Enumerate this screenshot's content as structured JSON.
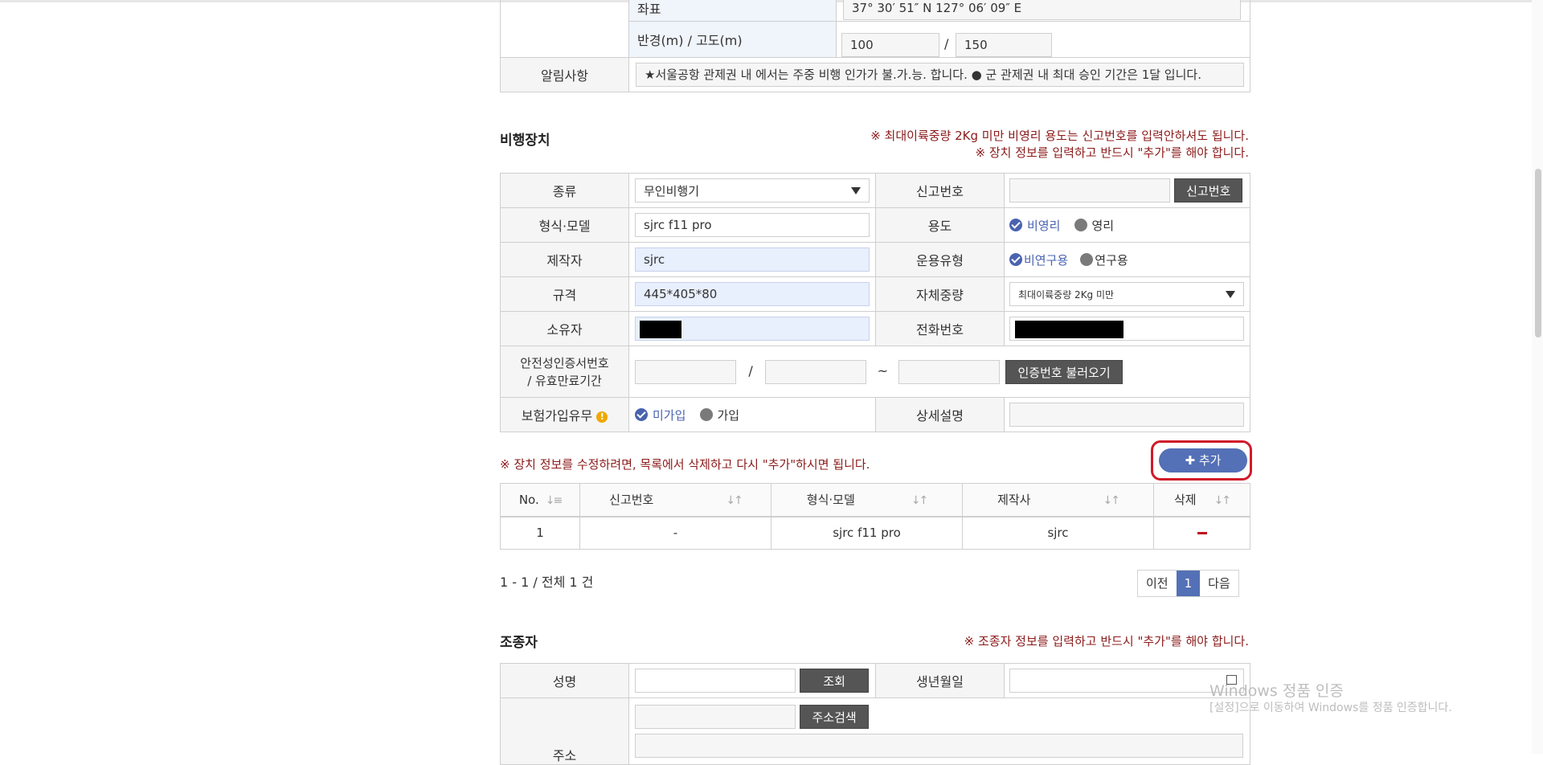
{
  "location": {
    "coord_label": "좌표",
    "coord_value": "37° 30′ 51″ N 127° 06′ 09″ E",
    "radius_label": "반경(m) / 고도(m)",
    "radius_value": "100",
    "altitude_value": "150",
    "separator": "/",
    "notice_label": "알림사항",
    "notice_text": "★서울공항 관제권 내 에서는 주중 비행 인가가 불.가.능. 합니다. ● 군 관제권 내 최대 승인 기간은 1달 입니다."
  },
  "device": {
    "section_title": "비행장치",
    "warning_1": "※ 최대이륙중량 2Kg 미만 비영리 용도는 신고번호를 입력안하셔도 됩니다.",
    "warning_2": "※ 장치 정보를 입력하고 반드시 \"추가\"를 해야 합니다.",
    "type_label": "종류",
    "type_value": "무인비행기",
    "report_no_label": "신고번호",
    "report_no_button": "신고번호",
    "model_label": "형식·모델",
    "model_value": "sjrc f11 pro",
    "purpose_label": "용도",
    "purpose_options": [
      "비영리",
      "영리"
    ],
    "maker_label": "제작자",
    "maker_value": "sjrc",
    "operation_label": "운용유형",
    "operation_options": [
      "비연구용",
      "연구용"
    ],
    "spec_label": "규격",
    "spec_value": "445*405*80",
    "weight_label": "자체중량",
    "weight_value": "최대이륙중량 2Kg 미만",
    "owner_label": "소유자",
    "phone_label": "전화번호",
    "safety_label_1": "안전성인증서번호",
    "safety_label_2": "/ 유효만료기간",
    "safety_sep": "/",
    "safety_tilde": "~",
    "safety_button": "인증번호 불러오기",
    "insurance_label": "보험가입유무",
    "insurance_options": [
      "미가입",
      "가입"
    ],
    "detail_label": "상세설명",
    "edit_note": "※ 장치 정보를 수정하려면, 목록에서 삭제하고 다시 \"추가\"하시면 됩니다.",
    "add_button": "추가"
  },
  "device_list": {
    "headers": [
      "No.",
      "신고번호",
      "형식·모델",
      "제작사",
      "삭제"
    ],
    "rows": [
      {
        "no": "1",
        "report_no": "-",
        "model": "sjrc f11 pro",
        "maker": "sjrc"
      }
    ],
    "summary": "1 - 1 / 전체 1 건",
    "pager": {
      "prev": "이전",
      "current": "1",
      "next": "다음"
    }
  },
  "pilot": {
    "section_title": "조종자",
    "warning": "※ 조종자 정보를 입력하고 반드시 \"추가\"를 해야 합니다.",
    "name_label": "성명",
    "lookup_button": "조회",
    "birth_label": "생년월일",
    "address_label": "주소",
    "address_search_button": "주소검색"
  },
  "watermark": {
    "line1": "Windows 정품 인증",
    "line2": "[설정]으로 이동하여 Windows를 정품 인증합니다."
  },
  "colors": {
    "accent": "#5470b6",
    "warning": "#8b1a1a",
    "highlight_ring": "#d11a2a",
    "dark_button": "#555555"
  }
}
